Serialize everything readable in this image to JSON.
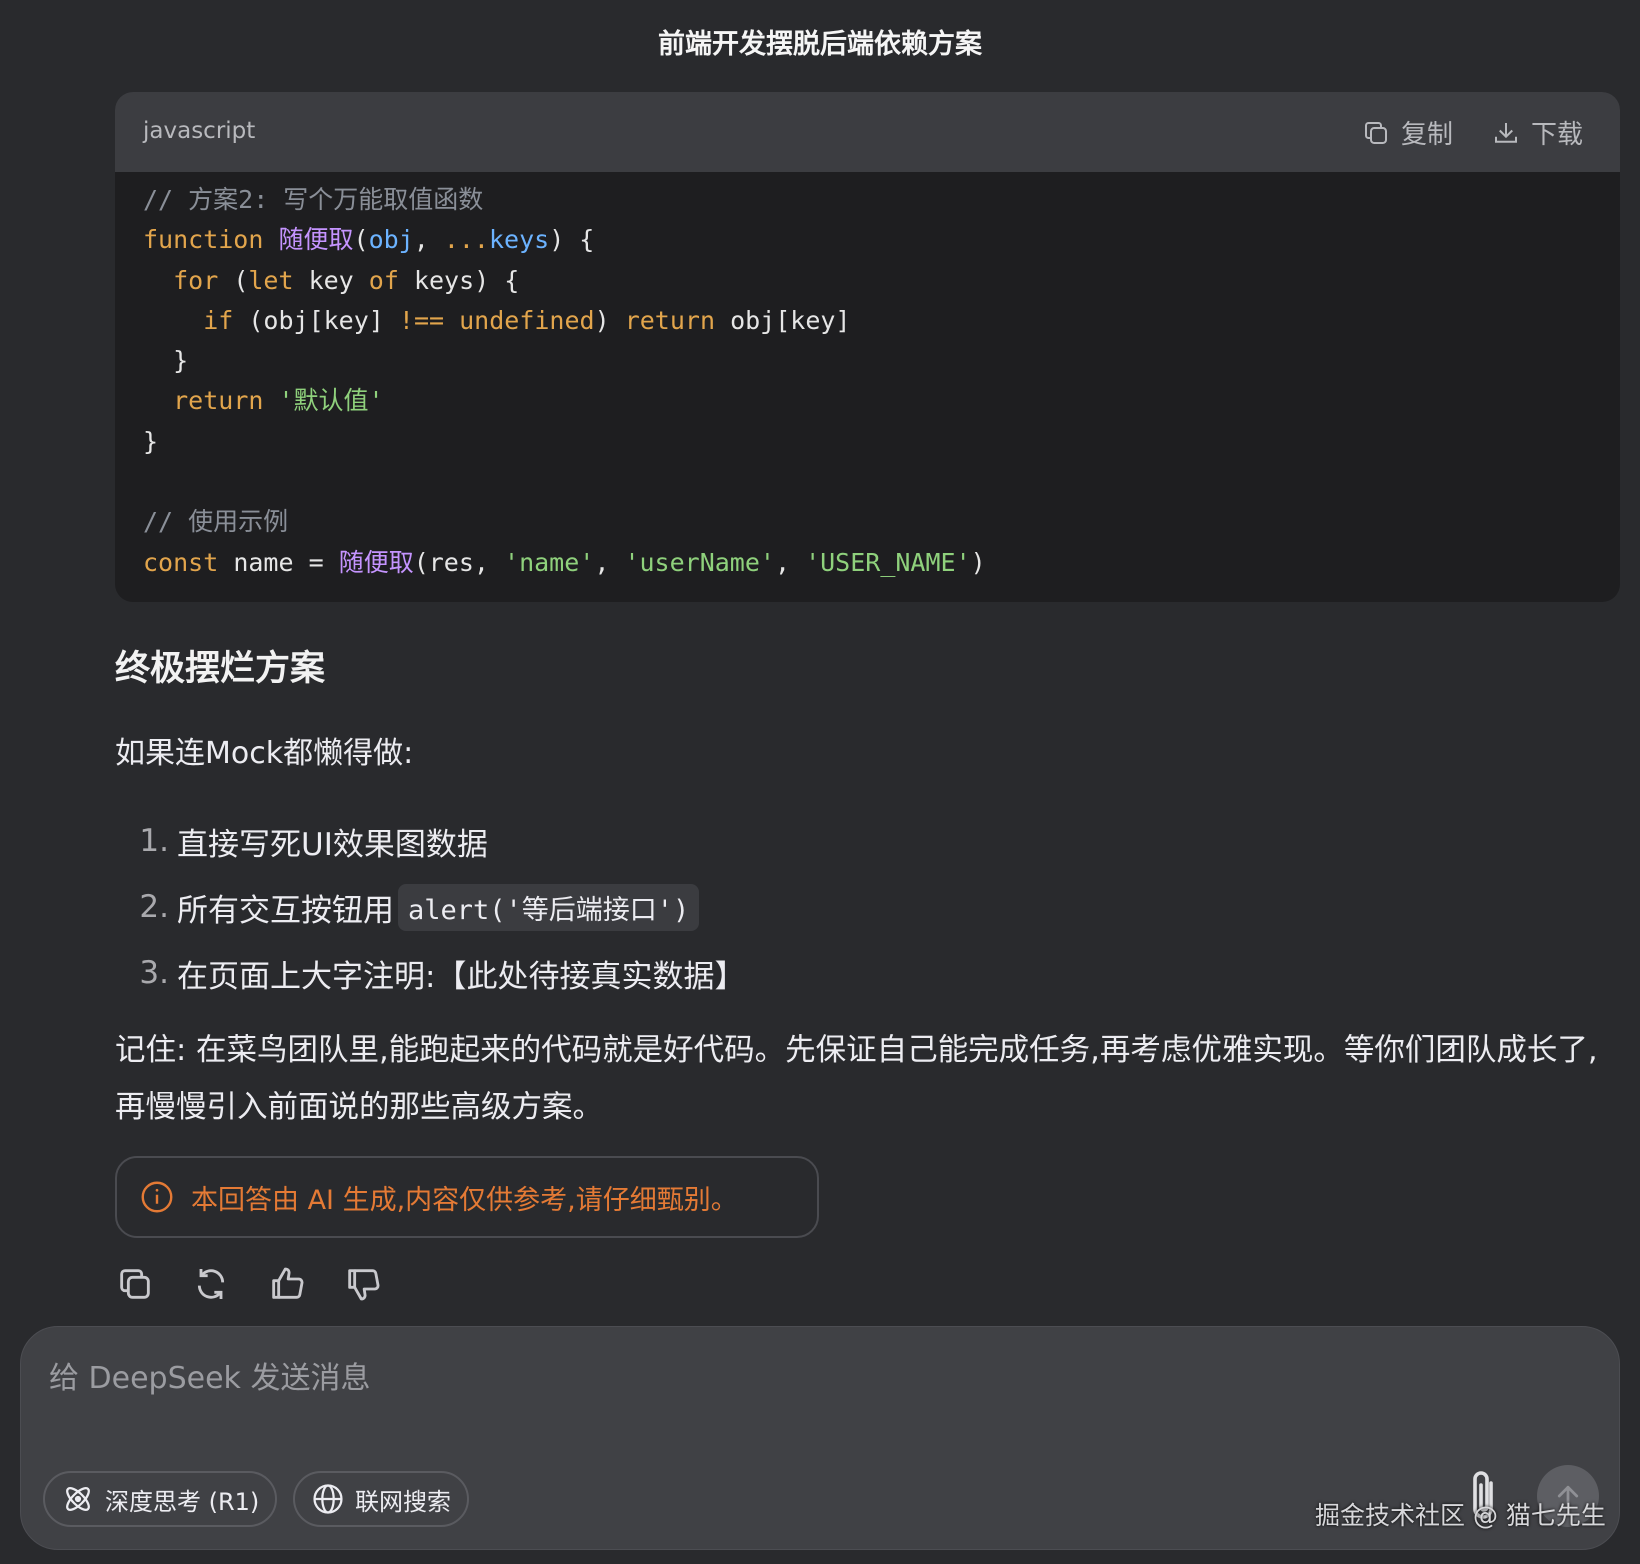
{
  "page_title": "前端开发摆脱后端依赖方案",
  "code_block": {
    "language": "javascript",
    "copy_label": "复制",
    "download_label": "下载",
    "lines": [
      [
        {
          "t": "comment",
          "v": "// 方案2: 写个万能取值函数"
        }
      ],
      [
        {
          "t": "kw",
          "v": "function"
        },
        {
          "t": "plain",
          "v": " "
        },
        {
          "t": "fn",
          "v": "随便取"
        },
        {
          "t": "plain",
          "v": "("
        },
        {
          "t": "param",
          "v": "obj"
        },
        {
          "t": "plain",
          "v": ", "
        },
        {
          "t": "kw",
          "v": "..."
        },
        {
          "t": "param",
          "v": "keys"
        },
        {
          "t": "plain",
          "v": ") {"
        }
      ],
      [
        {
          "t": "plain",
          "v": "  "
        },
        {
          "t": "kw",
          "v": "for"
        },
        {
          "t": "plain",
          "v": " ("
        },
        {
          "t": "kw",
          "v": "let"
        },
        {
          "t": "plain",
          "v": " key "
        },
        {
          "t": "kw",
          "v": "of"
        },
        {
          "t": "plain",
          "v": " keys) {"
        }
      ],
      [
        {
          "t": "plain",
          "v": "    "
        },
        {
          "t": "kw",
          "v": "if"
        },
        {
          "t": "plain",
          "v": " (obj[key] "
        },
        {
          "t": "kw",
          "v": "!=="
        },
        {
          "t": "plain",
          "v": " "
        },
        {
          "t": "kw",
          "v": "undefined"
        },
        {
          "t": "plain",
          "v": ") "
        },
        {
          "t": "kw",
          "v": "return"
        },
        {
          "t": "plain",
          "v": " obj[key]"
        }
      ],
      [
        {
          "t": "plain",
          "v": "  }"
        }
      ],
      [
        {
          "t": "plain",
          "v": "  "
        },
        {
          "t": "kw",
          "v": "return"
        },
        {
          "t": "plain",
          "v": " "
        },
        {
          "t": "str",
          "v": "'默认值'"
        }
      ],
      [
        {
          "t": "plain",
          "v": "}"
        }
      ],
      [],
      [
        {
          "t": "comment",
          "v": "// 使用示例"
        }
      ],
      [
        {
          "t": "kw",
          "v": "const"
        },
        {
          "t": "plain",
          "v": " name = "
        },
        {
          "t": "fn",
          "v": "随便取"
        },
        {
          "t": "plain",
          "v": "(res, "
        },
        {
          "t": "str",
          "v": "'name'"
        },
        {
          "t": "plain",
          "v": ", "
        },
        {
          "t": "str",
          "v": "'userName'"
        },
        {
          "t": "plain",
          "v": ", "
        },
        {
          "t": "str",
          "v": "'USER_NAME'"
        },
        {
          "t": "plain",
          "v": ")"
        }
      ]
    ]
  },
  "section_heading": "终极摆烂方案",
  "intro": "如果连Mock都懒得做:",
  "list": [
    {
      "num": "1.",
      "text": "直接写死UI效果图数据",
      "code": ""
    },
    {
      "num": "2.",
      "text": "所有交互按钮用",
      "code": "alert('等后端接口')"
    },
    {
      "num": "3.",
      "text": "在页面上大字注明:【此处待接真实数据】",
      "code": ""
    }
  ],
  "conclusion": "记住: 在菜鸟团队里,能跑起来的代码就是好代码。先保证自己能完成任务,再考虑优雅实现。等你们团队成长了,再慢慢引入前面说的那些高级方案。",
  "ai_notice": "本回答由 AI 生成,内容仅供参考,请仔细甄别。",
  "chat_input": {
    "placeholder": "给 DeepSeek 发送消息",
    "value": "",
    "deep_think_label": "深度思考 (R1)",
    "web_search_label": "联网搜索"
  },
  "watermark": "掘金技术社区 @ 猫七先生",
  "colors": {
    "background": "#292a2d",
    "code_bg": "#1e1e20",
    "keyword": "#e2a54c",
    "function": "#c594ff",
    "param": "#6cb3ff",
    "string": "#8fd17c",
    "comment": "#8a8f98",
    "notice": "#e47a35"
  }
}
